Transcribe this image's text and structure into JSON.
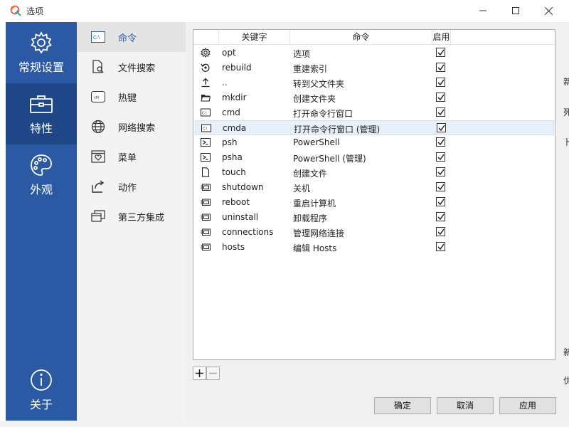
{
  "window": {
    "title": "选项"
  },
  "leftbar": {
    "items": [
      {
        "label": "常规设置",
        "icon": "gear-icon"
      },
      {
        "label": "特性",
        "icon": "toolbox-icon"
      },
      {
        "label": "外观",
        "icon": "palette-icon"
      },
      {
        "label": "关于",
        "icon": "info-icon"
      }
    ],
    "active_index": 1
  },
  "subnav": {
    "items": [
      {
        "label": "命令",
        "icon": "console-icon"
      },
      {
        "label": "文件搜索",
        "icon": "file-search-icon"
      },
      {
        "label": "热键",
        "icon": "ctrl-key-icon"
      },
      {
        "label": "网络搜索",
        "icon": "globe-icon"
      },
      {
        "label": "菜单",
        "icon": "menu-heart-icon"
      },
      {
        "label": "动作",
        "icon": "share-arrow-icon"
      },
      {
        "label": "第三方集成",
        "icon": "windows-stack-icon"
      }
    ],
    "active_index": 0
  },
  "table": {
    "headers": [
      "关键字",
      "命令",
      "启用"
    ],
    "rows": [
      {
        "icon": "gear-icon",
        "keyword": "opt",
        "command": "选项",
        "enabled": true
      },
      {
        "icon": "rebuild-icon",
        "keyword": "rebuild",
        "command": "重建索引",
        "enabled": true
      },
      {
        "icon": "upload-arrow-icon",
        "keyword": "..",
        "command": "转到父文件夹",
        "enabled": true
      },
      {
        "icon": "folder-icon",
        "keyword": "mkdir",
        "command": "创建文件夹",
        "enabled": true
      },
      {
        "icon": "console-icon",
        "keyword": "cmd",
        "command": "打开命令行窗口",
        "enabled": true
      },
      {
        "icon": "console-icon",
        "keyword": "cmda",
        "command": "打开命令行窗口 (管理)",
        "enabled": true
      },
      {
        "icon": "powershell-icon",
        "keyword": "psh",
        "command": "PowerShell",
        "enabled": true
      },
      {
        "icon": "powershell-icon",
        "keyword": "psha",
        "command": "PowerShell (管理)",
        "enabled": true
      },
      {
        "icon": "file-icon",
        "keyword": "touch",
        "command": "创建文件",
        "enabled": true
      },
      {
        "icon": "system-icon",
        "keyword": "shutdown",
        "command": "关机",
        "enabled": true
      },
      {
        "icon": "system-icon",
        "keyword": "reboot",
        "command": "重启计算机",
        "enabled": true
      },
      {
        "icon": "system-icon",
        "keyword": "uninstall",
        "command": "卸载程序",
        "enabled": true
      },
      {
        "icon": "system-icon",
        "keyword": "connections",
        "command": "管理网络连接",
        "enabled": true
      },
      {
        "icon": "system-icon",
        "keyword": "hosts",
        "command": "编辑 Hosts",
        "enabled": true
      }
    ],
    "selected_index": 5
  },
  "buttons": {
    "add": "+",
    "remove": "−",
    "ok": "确定",
    "cancel": "取消",
    "apply": "应用"
  },
  "edge_fragments": [
    "新",
    "死",
    "卜",
    "新",
    "优"
  ],
  "colors": {
    "sidebar_blue": "#2b59a3",
    "sidebar_active": "#1f4788",
    "accent_text": "#2b59a3",
    "selected_row": "#e6f0fa"
  }
}
